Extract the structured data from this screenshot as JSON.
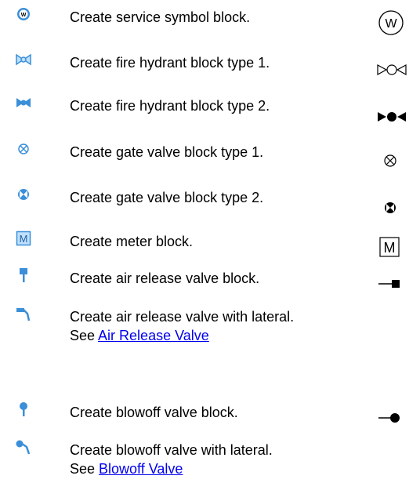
{
  "items": [
    {
      "icon": "service-symbol-tool-icon",
      "symbol": "service-symbol",
      "description": "Create service symbol block.",
      "symbol_text": "W"
    },
    {
      "icon": "fire-hydrant-type1-tool-icon",
      "symbol": "fire-hydrant-type1-symbol",
      "description": "Create fire hydrant block type 1."
    },
    {
      "icon": "fire-hydrant-type2-tool-icon",
      "symbol": "fire-hydrant-type2-symbol",
      "description": "Create fire hydrant block type 2."
    },
    {
      "icon": "gate-valve-type1-tool-icon",
      "symbol": "gate-valve-type1-symbol",
      "description": "Create gate valve block type 1."
    },
    {
      "icon": "gate-valve-type2-tool-icon",
      "symbol": "gate-valve-type2-symbol",
      "description": "Create gate valve block type 2."
    },
    {
      "icon": "meter-tool-icon",
      "symbol": "meter-symbol",
      "description": "Create meter block.",
      "symbol_text": "M"
    },
    {
      "icon": "air-release-valve-tool-icon",
      "symbol": "air-release-valve-symbol",
      "description": "Create air release valve block."
    },
    {
      "icon": "air-release-valve-lateral-tool-icon",
      "description": "Create air release valve with lateral.",
      "see_prefix": "See ",
      "link_text": "Air Release Valve"
    },
    {
      "icon": "blowoff-valve-tool-icon",
      "symbol": "blowoff-valve-symbol",
      "description": "Create blowoff valve block."
    },
    {
      "icon": "blowoff-valve-lateral-tool-icon",
      "description": "Create blowoff valve with lateral.",
      "see_prefix": "See ",
      "link_text": "Blowoff Valve"
    }
  ],
  "colors": {
    "icon_blue": "#3a8fd8",
    "icon_light": "#bfe0ff",
    "link": "#0000ee",
    "text": "#000000"
  }
}
